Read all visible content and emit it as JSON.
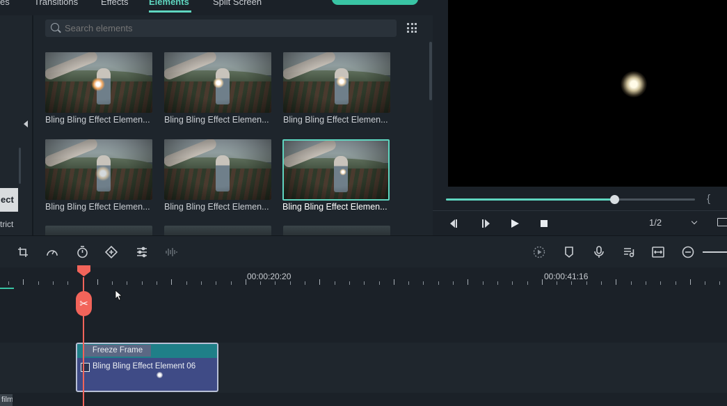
{
  "tabs": [
    {
      "label": "es",
      "active": false
    },
    {
      "label": "Transitions",
      "active": false
    },
    {
      "label": "Effects",
      "active": false
    },
    {
      "label": "Elements",
      "active": true
    },
    {
      "label": "Split Screen",
      "active": false
    }
  ],
  "left_panel": {
    "button_label": "ect",
    "text": "trict"
  },
  "search": {
    "placeholder": "Search elements",
    "value": ""
  },
  "elements": [
    {
      "caption": "Bling Bling Effect Elemen...",
      "selected": false
    },
    {
      "caption": "Bling Bling Effect Elemen...",
      "selected": false
    },
    {
      "caption": "Bling Bling Effect Elemen...",
      "selected": false
    },
    {
      "caption": "Bling Bling Effect Elemen...",
      "selected": false
    },
    {
      "caption": "Bling Bling Effect Elemen...",
      "selected": false
    },
    {
      "caption": "Bling Bling Effect Elemen...",
      "selected": true
    }
  ],
  "player": {
    "progress_fraction": 0.675,
    "page": "1/2",
    "bracket": "{"
  },
  "toolbar_left": [
    "crop-icon",
    "speed-icon",
    "duration-timer-icon",
    "keyframe-icon",
    "adjust-sliders-icon",
    "audio-waveform-icon"
  ],
  "toolbar_right": [
    "render-preview-icon",
    "marker-icon",
    "microphone-icon",
    "audio-mixer-icon",
    "fit-timeline-icon",
    "zoom-out-icon"
  ],
  "timeline": {
    "labels": [
      "00:00:20:20",
      "00:00:41:16"
    ],
    "clip": {
      "header": "Freeze Frame",
      "title": "Bling Bling Effect Element 06"
    },
    "bottom_chip": "film"
  },
  "colors": {
    "accent": "#5fd6c0",
    "playhead": "#f2645a",
    "clip": "#3f4b86",
    "clip_header": "#1f7f88"
  }
}
